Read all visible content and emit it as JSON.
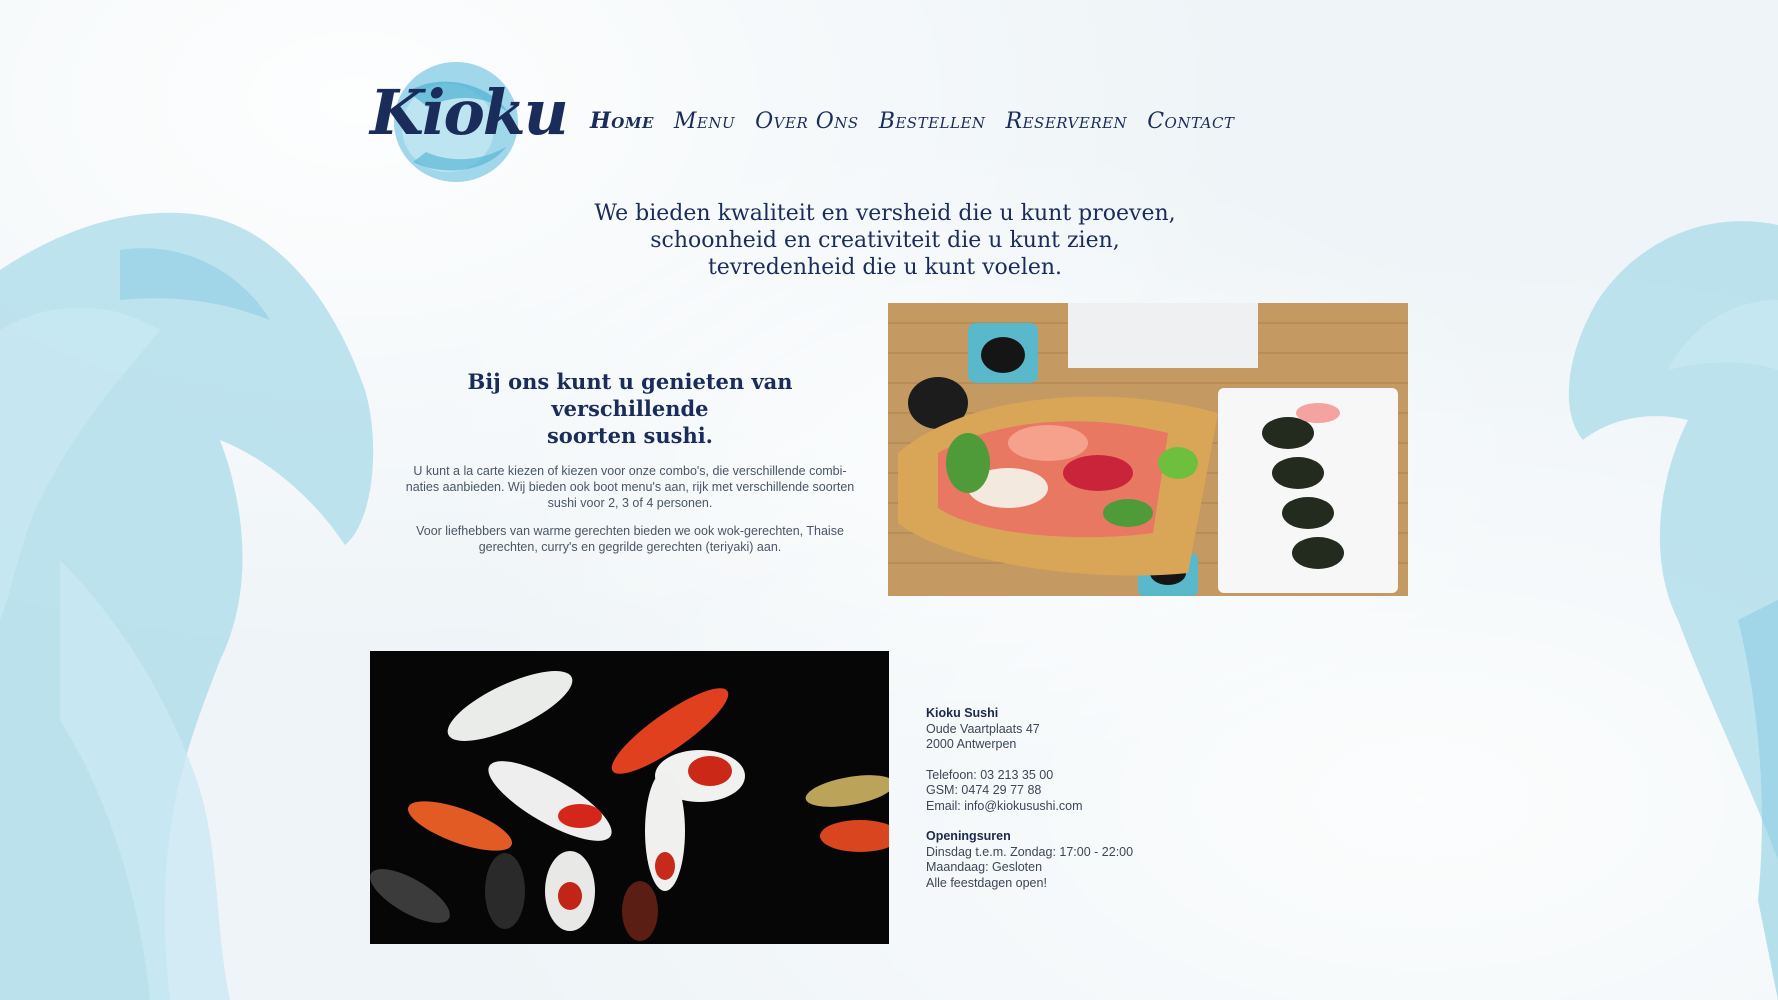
{
  "brand": {
    "logo_text": "Kioku",
    "accent_color": "#5bb8d6",
    "ink_color": "#1a2d5a"
  },
  "nav": {
    "items": [
      {
        "label": "Home",
        "active": true
      },
      {
        "label": "Menu",
        "active": false
      },
      {
        "label": "Over Ons",
        "active": false
      },
      {
        "label": "Bestellen",
        "active": false
      },
      {
        "label": "Reserveren",
        "active": false
      },
      {
        "label": "Contact",
        "active": false
      }
    ]
  },
  "tagline": {
    "line1": "We bieden kwaliteit en versheid die u kunt proeven,",
    "line2": "schoonheid en creativiteit die u kunt zien,",
    "line3": "tevredenheid die u kunt voelen."
  },
  "intro": {
    "heading_line1": "Bij ons kunt u genieten van verschillende",
    "heading_line2": "soorten sushi.",
    "paragraph1": "U kunt a la carte kiezen of kiezen voor onze combo's, die verschillende combi-naties aanbieden. Wij bieden ook boot menu's aan, rijk met verschillende soorten sushi voor 2, 3 of 4 personen.",
    "paragraph2": "Voor liefhebbers van warme gerechten bieden we ook wok-gerechten, Thaise gerechten, curry's en gegrilde gerechten (teriyaki) aan."
  },
  "images": {
    "sushi": "sushi-boat-photo",
    "koi": "koi-fish-photo"
  },
  "contact": {
    "name": "Kioku Sushi",
    "street": "Oude Vaartplaats 47",
    "city": "2000 Antwerpen",
    "phone": "Telefoon: 03 213 35 00",
    "gsm": "GSM: 0474 29 77 88",
    "email": "Email: info@kiokusushi.com",
    "hours_title": "Openingsuren",
    "hours_line1": "Dinsdag t.e.m. Zondag: 17:00 - 22:00",
    "hours_line2": "Maandaag: Gesloten",
    "hours_line3": "Alle feestdagen open!"
  }
}
